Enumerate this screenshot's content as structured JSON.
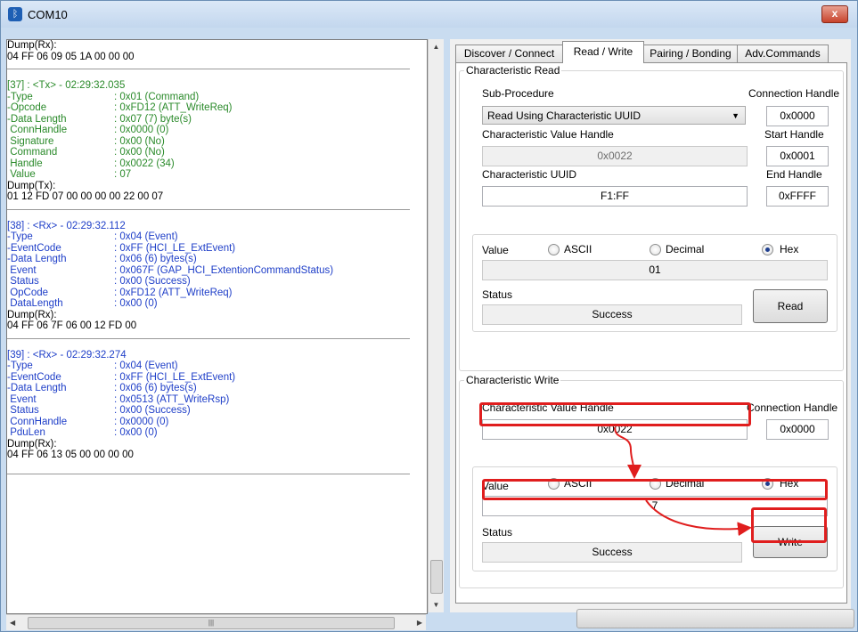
{
  "window": {
    "title": "COM10",
    "close_label": "x"
  },
  "log": {
    "first_dump_label": "Dump(Rx):",
    "first_dump_value": "04 FF 06 09 05 1A 00 00 00",
    "entries": [
      {
        "header": "[37] : <Tx> - 02:29:32.035",
        "fields": [
          [
            "-Type",
            ": 0x01 (Command)"
          ],
          [
            "-Opcode",
            ": 0xFD12 (ATT_WriteReq)"
          ],
          [
            "-Data Length",
            ": 0x07 (7) byte(s)"
          ],
          [
            " ConnHandle",
            ": 0x0000 (0)"
          ],
          [
            " Signature",
            ": 0x00 (No)"
          ],
          [
            " Command",
            ": 0x00 (No)"
          ],
          [
            " Handle",
            ": 0x0022 (34)"
          ],
          [
            " Value",
            ": 07"
          ]
        ],
        "dump_label": "Dump(Tx):",
        "dump_value": "01 12 FD 07 00 00 00 00 22 00 07"
      },
      {
        "header": "[38] : <Rx> - 02:29:32.112",
        "fields": [
          [
            "-Type",
            ": 0x04 (Event)"
          ],
          [
            "-EventCode",
            ": 0xFF (HCI_LE_ExtEvent)"
          ],
          [
            "-Data Length",
            ": 0x06 (6) bytes(s)"
          ],
          [
            " Event",
            ": 0x067F (GAP_HCI_ExtentionCommandStatus)"
          ],
          [
            " Status",
            ": 0x00 (Success)"
          ],
          [
            " OpCode",
            ": 0xFD12 (ATT_WriteReq)"
          ],
          [
            " DataLength",
            ": 0x00 (0)"
          ]
        ],
        "dump_label": "Dump(Rx):",
        "dump_value": "04 FF 06 7F 06 00 12 FD 00"
      },
      {
        "header": "[39] : <Rx> - 02:29:32.274",
        "fields": [
          [
            "-Type",
            ": 0x04 (Event)"
          ],
          [
            "-EventCode",
            ": 0xFF (HCI_LE_ExtEvent)"
          ],
          [
            "-Data Length",
            ": 0x06 (6) bytes(s)"
          ],
          [
            " Event",
            ": 0x0513 (ATT_WriteRsp)"
          ],
          [
            " Status",
            ": 0x00 (Success)"
          ],
          [
            " ConnHandle",
            ": 0x0000 (0)"
          ],
          [
            " PduLen",
            ": 0x00 (0)"
          ]
        ],
        "dump_label": "Dump(Rx):",
        "dump_value": "04 FF 06 13 05 00 00 00 00"
      }
    ]
  },
  "tabs": [
    {
      "label": "Discover / Connect",
      "active": false
    },
    {
      "label": "Read / Write",
      "active": true
    },
    {
      "label": "Pairing / Bonding",
      "active": false
    },
    {
      "label": "Adv.Commands",
      "active": false
    }
  ],
  "read": {
    "group_title": "Characteristic Read",
    "sub_procedure_label": "Sub-Procedure",
    "sub_procedure_value": "Read Using Characteristic UUID",
    "connection_handle_label": "Connection Handle",
    "connection_handle_value": "0x0000",
    "value_handle_label": "Characteristic Value Handle",
    "value_handle_value": "0x0022",
    "start_handle_label": "Start Handle",
    "start_handle_value": "0x0001",
    "uuid_label": "Characteristic UUID",
    "uuid_value": "F1:FF",
    "end_handle_label": "End Handle",
    "end_handle_value": "0xFFFF",
    "value_label": "Value",
    "ascii_label": "ASCII",
    "decimal_label": "Decimal",
    "hex_label": "Hex",
    "value": "01",
    "status_label": "Status",
    "status_value": "Success",
    "read_button": "Read"
  },
  "write": {
    "group_title": "Characteristic Write",
    "value_handle_label": "Characteristic Value Handle",
    "value_handle_value": "0x0022",
    "connection_handle_label": "Connection Handle",
    "connection_handle_value": "0x0000",
    "value_label": "Value",
    "ascii_label": "ASCII",
    "decimal_label": "Decimal",
    "hex_label": "Hex",
    "value": "7",
    "status_label": "Status",
    "status_value": "Success",
    "write_button": "Write"
  },
  "colors": {
    "tx_text": "#2a8a2a",
    "rx_text": "#1e3ec8",
    "highlight": "#e01e1e"
  }
}
